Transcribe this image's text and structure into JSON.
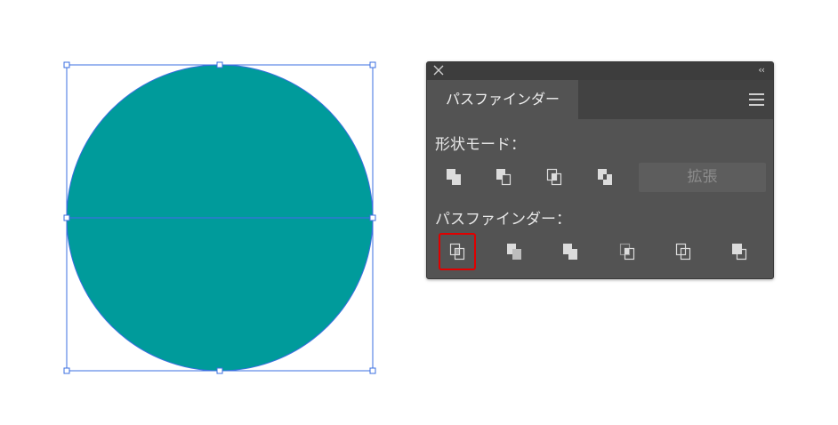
{
  "panel": {
    "tab_title": "パスファインダー",
    "shape_modes_label": "形状モード：",
    "pathfinders_label": "パスファインダー：",
    "expand_label": "拡張",
    "collapse_glyph": "‹‹"
  },
  "shape_modes": [
    {
      "icon": "unite-icon"
    },
    {
      "icon": "minus-front-icon"
    },
    {
      "icon": "intersect-icon"
    },
    {
      "icon": "exclude-icon"
    }
  ],
  "pathfinders": [
    {
      "icon": "divide-icon",
      "selected": true
    },
    {
      "icon": "trim-icon"
    },
    {
      "icon": "merge-icon"
    },
    {
      "icon": "crop-icon"
    },
    {
      "icon": "outline-icon"
    },
    {
      "icon": "minus-back-icon"
    }
  ],
  "colors": {
    "shape_fill": "#009B9B",
    "selection": "#3B6FE0",
    "panel_bg": "#535353",
    "highlight": "#E00000"
  }
}
